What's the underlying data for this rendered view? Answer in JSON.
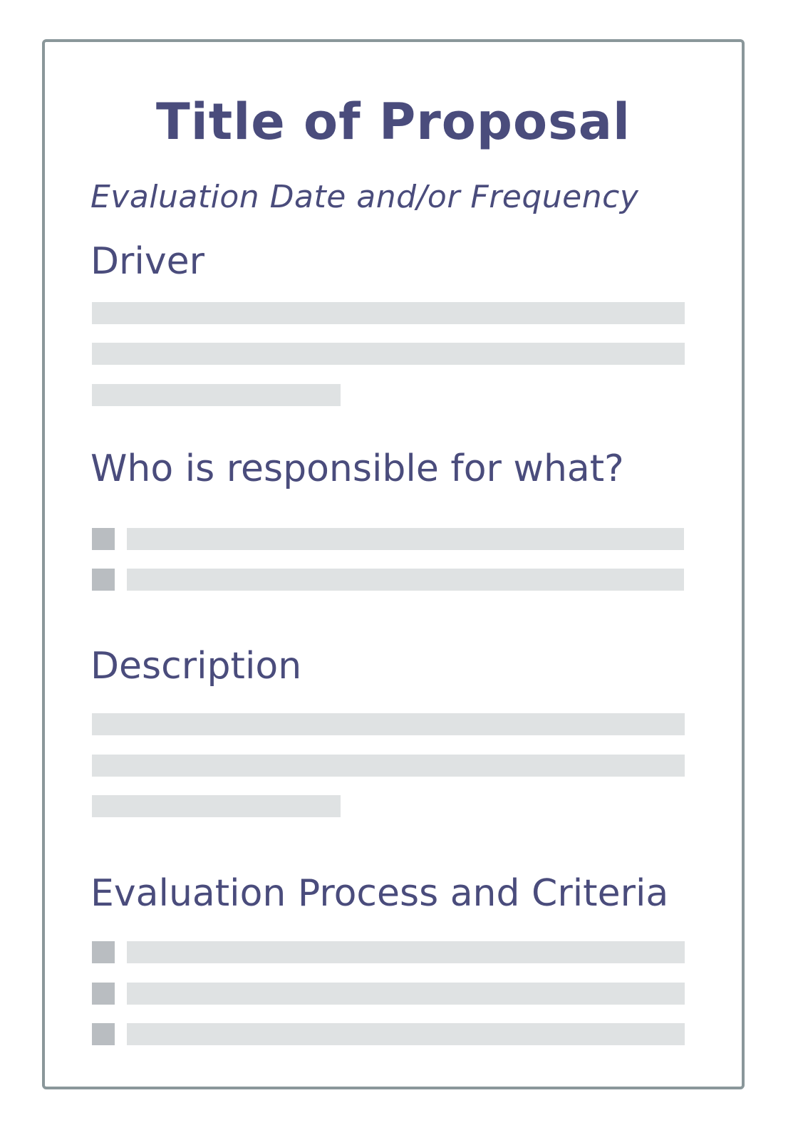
{
  "document": {
    "title": "Title of Proposal",
    "subtitle": "Evaluation Date and/or Frequency",
    "sections": [
      {
        "heading": "Driver",
        "content": "text-lines",
        "line_count": 3
      },
      {
        "heading": "Who is responsible for what?",
        "content": "bullet-list",
        "line_count": 2
      },
      {
        "heading": "Description",
        "content": "text-lines",
        "line_count": 3
      },
      {
        "heading": "Evaluation Process and Criteria",
        "content": "bullet-list",
        "line_count": 3
      }
    ]
  },
  "colors": {
    "text": "#4a4c7c",
    "border": "#8a979a",
    "placeholder_line": "#dfe2e3",
    "bullet": "#b9bdc1"
  }
}
